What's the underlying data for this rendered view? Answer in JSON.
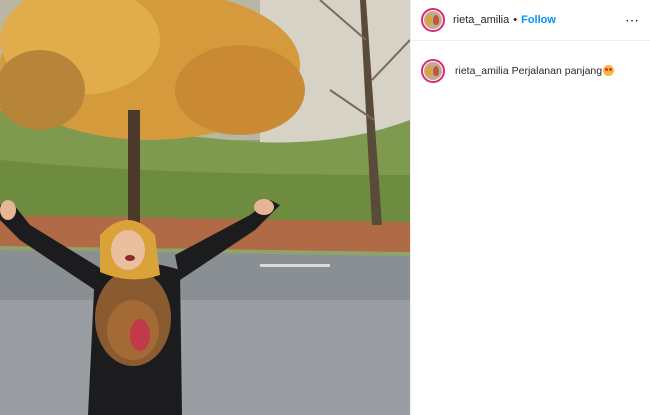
{
  "post": {
    "username": "rieta_amilia",
    "separator": "•",
    "follow_label": "Follow",
    "more_icon": "⋯",
    "caption_user": "rieta_amilia",
    "caption_text": "Perjalanan panjang",
    "caption_emoji": "star-struck-face-icon"
  },
  "colors": {
    "accent": "#0095f6",
    "text": "#262626",
    "avatar_ring": "#d62976"
  }
}
